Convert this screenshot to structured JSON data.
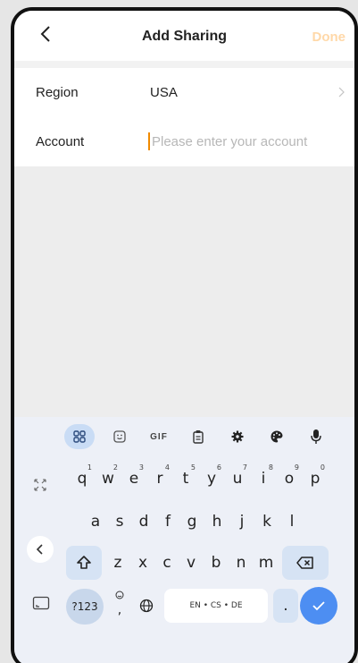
{
  "header": {
    "title": "Add Sharing",
    "done_label": "Done"
  },
  "form": {
    "region_label": "Region",
    "region_value": "USA",
    "account_label": "Account",
    "account_placeholder": "Please enter your account",
    "account_value": ""
  },
  "keyboard": {
    "toolbar": [
      "apps-icon",
      "sticker-icon",
      "GIF",
      "clipboard-icon",
      "settings-icon",
      "palette-icon",
      "mic-icon"
    ],
    "gif_label": "GIF",
    "row1": [
      {
        "key": "q",
        "hint": "1"
      },
      {
        "key": "w",
        "hint": "2"
      },
      {
        "key": "e",
        "hint": "3"
      },
      {
        "key": "r",
        "hint": "4"
      },
      {
        "key": "t",
        "hint": "5"
      },
      {
        "key": "y",
        "hint": "6"
      },
      {
        "key": "u",
        "hint": "7"
      },
      {
        "key": "i",
        "hint": "8"
      },
      {
        "key": "o",
        "hint": "9"
      },
      {
        "key": "p",
        "hint": "0"
      }
    ],
    "row2": [
      "a",
      "s",
      "d",
      "f",
      "g",
      "h",
      "j",
      "k",
      "l"
    ],
    "row3": [
      "z",
      "x",
      "c",
      "v",
      "b",
      "n",
      "m"
    ],
    "symbols_label": "?123",
    "comma_label": ",",
    "space_label": "EN • CS • DE",
    "period_label": "."
  },
  "colors": {
    "accent": "#f08a00",
    "done_disabled": "#ffd8a8",
    "enter_key": "#4d8ef2"
  }
}
